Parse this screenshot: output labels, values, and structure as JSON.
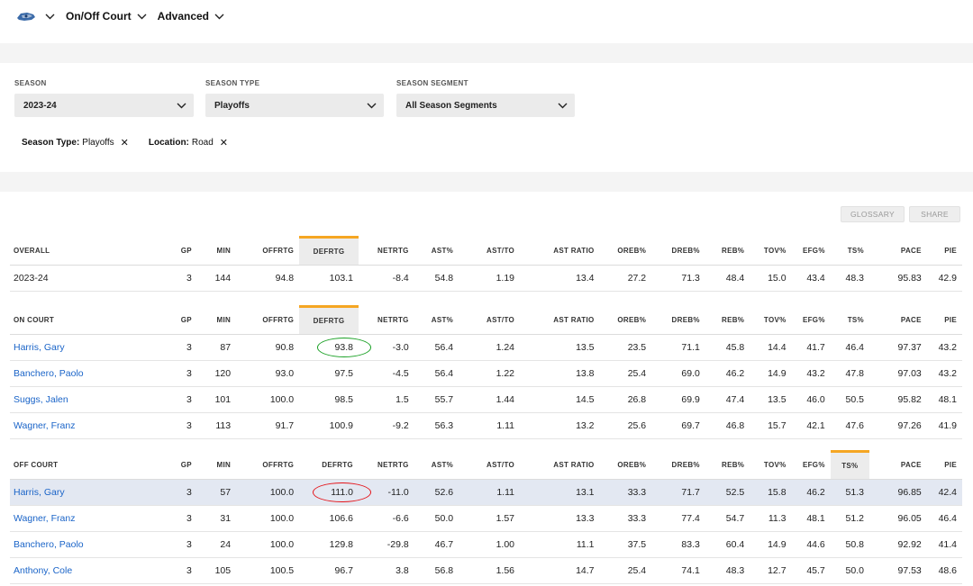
{
  "nav": {
    "team_icon": "magic-logo-icon",
    "items": [
      {
        "label": "On/Off Court"
      },
      {
        "label": "Advanced"
      }
    ]
  },
  "filters": [
    {
      "label": "SEASON",
      "value": "2023-24"
    },
    {
      "label": "SEASON TYPE",
      "value": "Playoffs"
    },
    {
      "label": "SEASON SEGMENT",
      "value": "All Season Segments"
    }
  ],
  "chips": [
    {
      "key": "Season Type:",
      "value": "Playoffs"
    },
    {
      "key": "Location:",
      "value": "Road"
    }
  ],
  "buttons": {
    "glossary": "GLOSSARY",
    "share": "SHARE"
  },
  "columns": [
    "GP",
    "MIN",
    "OFFRTG",
    "DEFRTG",
    "NETRTG",
    "AST%",
    "AST/TO",
    "AST RATIO",
    "OREB%",
    "DREB%",
    "REB%",
    "TOV%",
    "EFG%",
    "TS%",
    "PACE",
    "PIE"
  ],
  "overall": {
    "title": "OVERALL",
    "rows": [
      {
        "name": "2023-24",
        "vals": [
          "3",
          "144",
          "94.8",
          "103.1",
          "-8.4",
          "54.8",
          "1.19",
          "13.4",
          "27.2",
          "71.3",
          "48.4",
          "15.0",
          "43.4",
          "48.3",
          "95.83",
          "42.9"
        ]
      }
    ]
  },
  "on_court": {
    "title": "ON COURT",
    "rows": [
      {
        "name": "Harris, Gary",
        "vals": [
          "3",
          "87",
          "90.8",
          "93.8",
          "-3.0",
          "56.4",
          "1.24",
          "13.5",
          "23.5",
          "71.1",
          "45.8",
          "14.4",
          "41.7",
          "46.4",
          "97.37",
          "43.2"
        ]
      },
      {
        "name": "Banchero, Paolo",
        "vals": [
          "3",
          "120",
          "93.0",
          "97.5",
          "-4.5",
          "56.4",
          "1.22",
          "13.8",
          "25.4",
          "69.0",
          "46.2",
          "14.9",
          "43.2",
          "47.8",
          "97.03",
          "43.2"
        ]
      },
      {
        "name": "Suggs, Jalen",
        "vals": [
          "3",
          "101",
          "100.0",
          "98.5",
          "1.5",
          "55.7",
          "1.44",
          "14.5",
          "26.8",
          "69.9",
          "47.4",
          "13.5",
          "46.0",
          "50.5",
          "95.82",
          "48.1"
        ]
      },
      {
        "name": "Wagner, Franz",
        "vals": [
          "3",
          "113",
          "91.7",
          "100.9",
          "-9.2",
          "56.3",
          "1.11",
          "13.2",
          "25.6",
          "69.7",
          "46.8",
          "15.7",
          "42.1",
          "47.6",
          "97.26",
          "41.9"
        ]
      }
    ]
  },
  "off_court": {
    "title": "OFF COURT",
    "rows": [
      {
        "name": "Harris, Gary",
        "vals": [
          "3",
          "57",
          "100.0",
          "111.0",
          "-11.0",
          "52.6",
          "1.11",
          "13.1",
          "33.3",
          "71.7",
          "52.5",
          "15.8",
          "46.2",
          "51.3",
          "96.85",
          "42.4"
        ]
      },
      {
        "name": "Wagner, Franz",
        "vals": [
          "3",
          "31",
          "100.0",
          "106.6",
          "-6.6",
          "50.0",
          "1.57",
          "13.3",
          "33.3",
          "77.4",
          "54.7",
          "11.3",
          "48.1",
          "51.2",
          "96.05",
          "46.4"
        ]
      },
      {
        "name": "Banchero, Paolo",
        "vals": [
          "3",
          "24",
          "100.0",
          "129.8",
          "-29.8",
          "46.7",
          "1.00",
          "11.1",
          "37.5",
          "83.3",
          "60.4",
          "14.9",
          "44.6",
          "50.8",
          "92.92",
          "41.4"
        ]
      },
      {
        "name": "Anthony, Cole",
        "vals": [
          "3",
          "105",
          "100.5",
          "96.7",
          "3.8",
          "56.8",
          "1.56",
          "14.7",
          "25.4",
          "74.1",
          "48.3",
          "12.7",
          "45.7",
          "50.0",
          "97.53",
          "48.6"
        ]
      }
    ]
  },
  "colors": {
    "accent": "#f5a623",
    "link": "#1a64c8",
    "highlight_row": "#e3e8f2",
    "ring_green": "#19a024",
    "ring_red": "#e4141a"
  }
}
